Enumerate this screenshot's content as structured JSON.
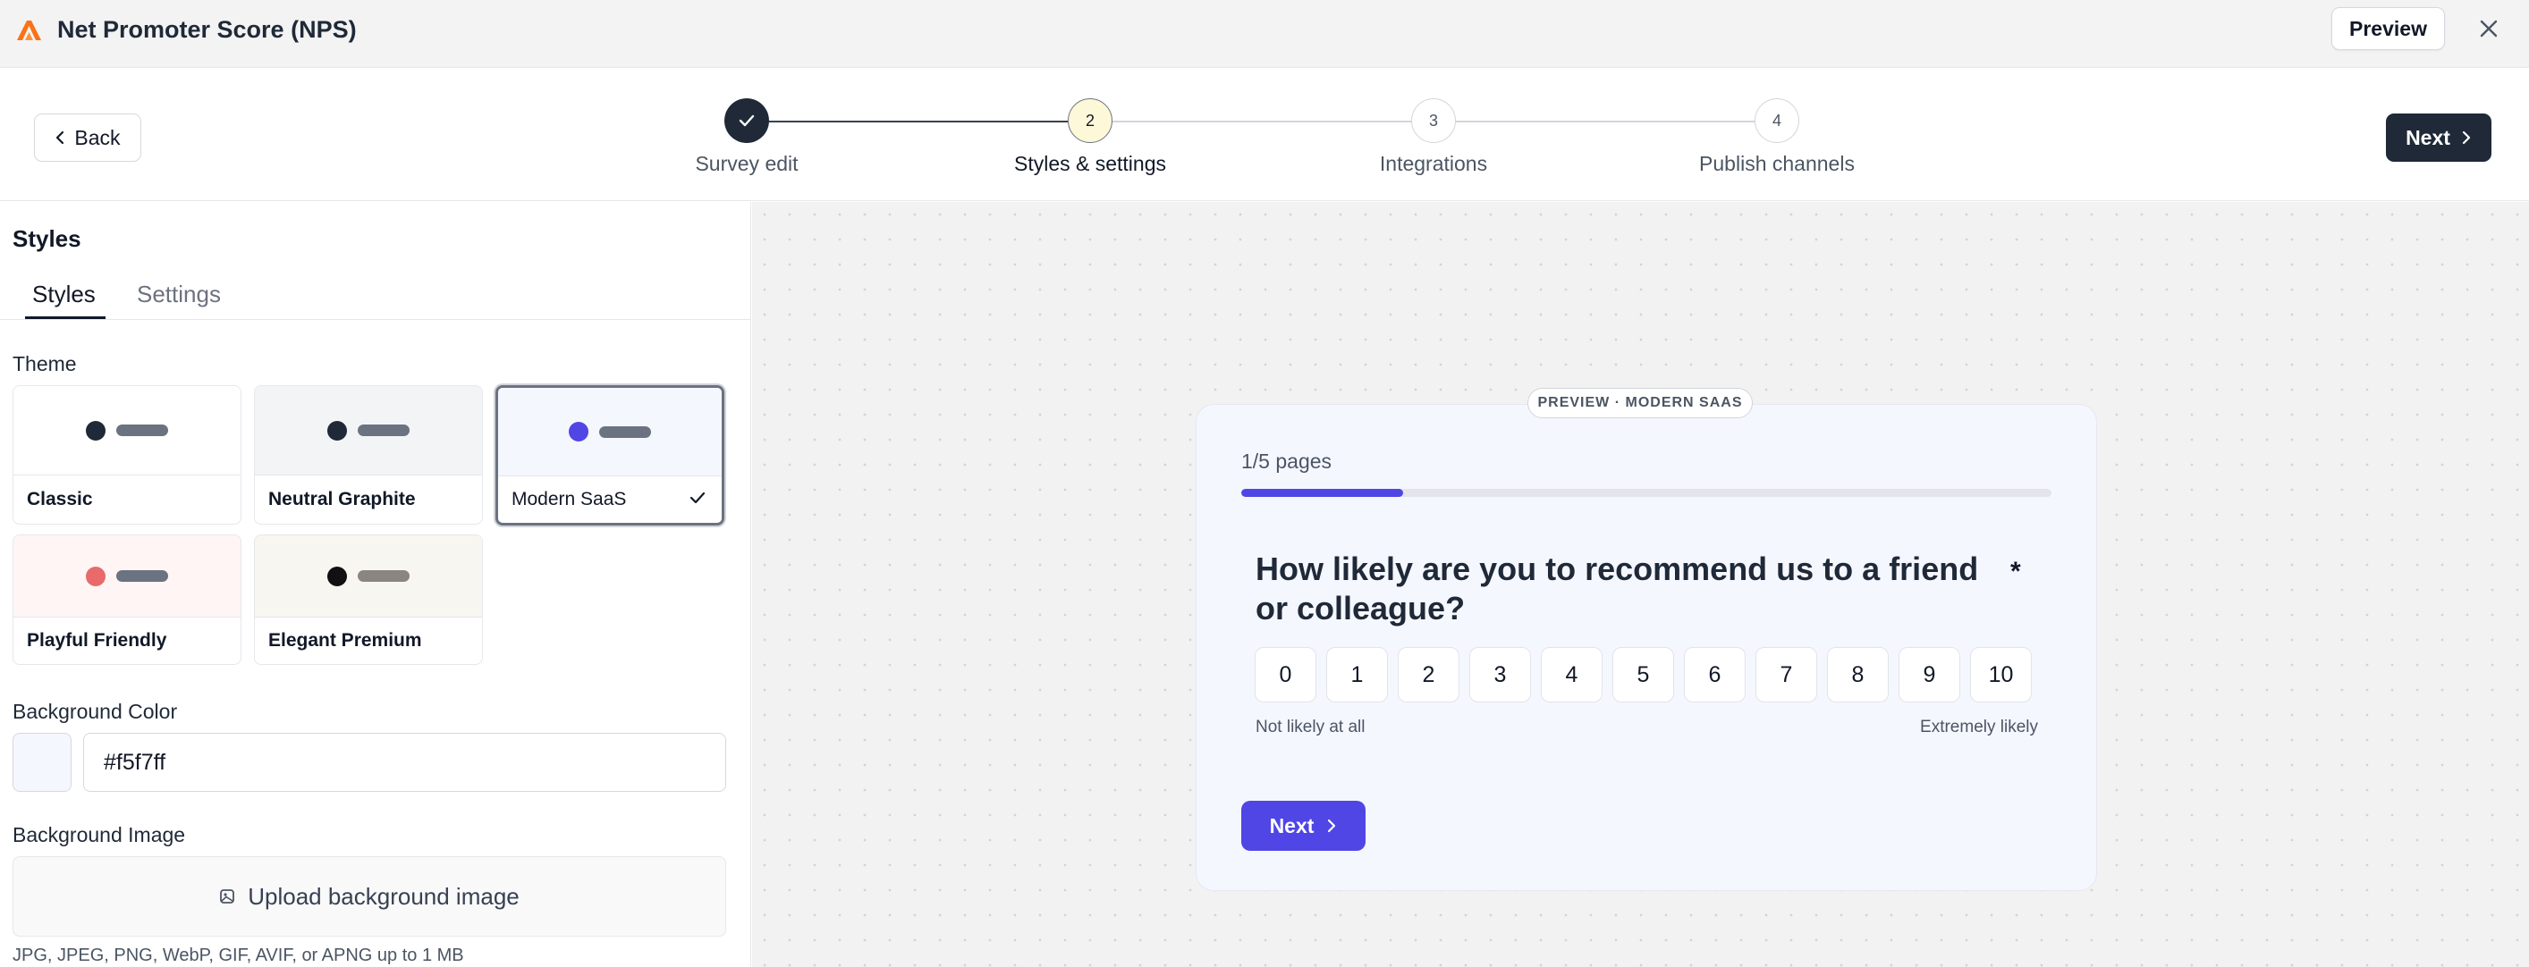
{
  "topbar": {
    "app_title": "Net Promoter Score (NPS)",
    "preview_label": "Preview",
    "logo_icon": "brand-logo-icon",
    "close_icon": "close-icon"
  },
  "stepper": {
    "back_label": "Back",
    "next_label": "Next",
    "steps": [
      {
        "number": "",
        "label": "Survey edit",
        "state": "completed"
      },
      {
        "number": "2",
        "label": "Styles & settings",
        "state": "current"
      },
      {
        "number": "3",
        "label": "Integrations",
        "state": "upcoming"
      },
      {
        "number": "4",
        "label": "Publish channels",
        "state": "upcoming"
      }
    ]
  },
  "panel": {
    "title": "Styles",
    "tabs": [
      {
        "label": "Styles",
        "active": true
      },
      {
        "label": "Settings",
        "active": false
      }
    ],
    "theme_label": "Theme",
    "themes": [
      {
        "name": "Classic",
        "swatch_bg": "#ffffff",
        "dot": "#1f2937",
        "bar": "#6b7280",
        "selected": false
      },
      {
        "name": "Neutral Graphite",
        "swatch_bg": "#f3f4f6",
        "dot": "#1f2937",
        "bar": "#6b7280",
        "selected": false
      },
      {
        "name": "Modern SaaS",
        "swatch_bg": "#f5f7ff",
        "dot": "#4f46e5",
        "bar": "#6b7280",
        "selected": true
      },
      {
        "name": "Playful Friendly",
        "swatch_bg": "#fff5f5",
        "dot": "#e86a6a",
        "bar": "#6b7280",
        "selected": false
      },
      {
        "name": "Elegant Premium",
        "swatch_bg": "#f8f6f1",
        "dot": "#111111",
        "bar": "#8a8580",
        "selected": false
      }
    ],
    "bg_color_label": "Background Color",
    "bg_color_value": "#f5f7ff",
    "bg_image_label": "Background Image",
    "upload_label": "Upload background image",
    "upload_hint": "JPG, JPEG, PNG, WebP, GIF, AVIF, or APNG up to 1 MB"
  },
  "preview": {
    "badge": "PREVIEW · MODERN SAAS",
    "pages": "1/5 pages",
    "progress_fraction": 0.2,
    "question": "How likely are you to recommend us to a friend or colleague?",
    "required_mark": "*",
    "scale": [
      "0",
      "1",
      "2",
      "3",
      "4",
      "5",
      "6",
      "7",
      "8",
      "9",
      "10"
    ],
    "low_label": "Not likely at all",
    "high_label": "Extremely likely",
    "next_label": "Next"
  },
  "colors": {
    "accent": "#4f46e5",
    "dark_button": "#1f2937",
    "brand_logo": "#f97316"
  }
}
